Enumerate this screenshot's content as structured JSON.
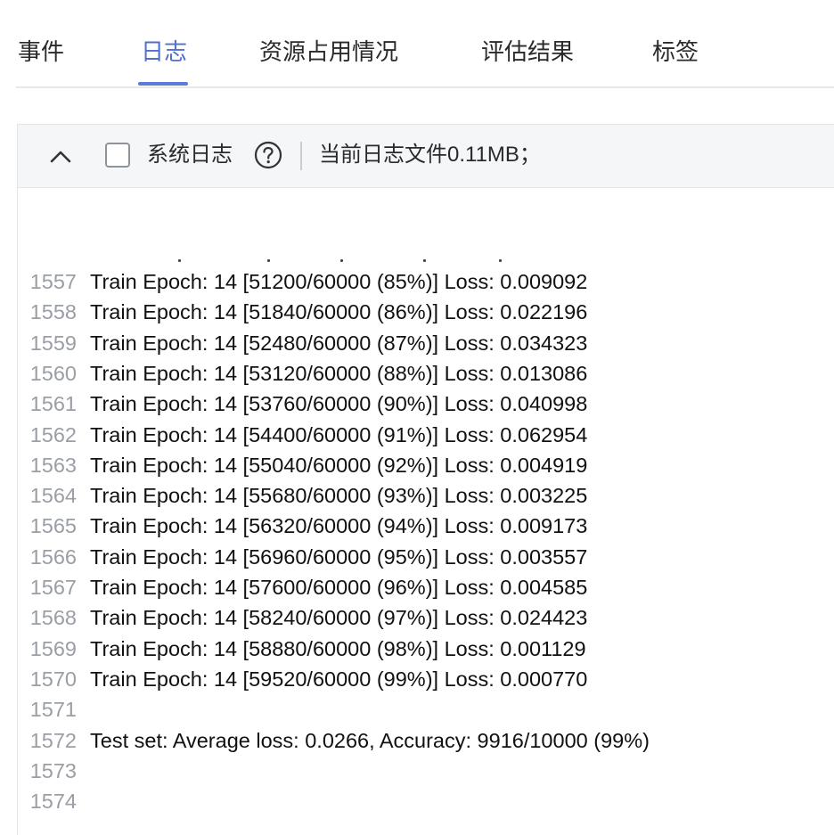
{
  "tabs": [
    {
      "label": "事件"
    },
    {
      "label": "日志"
    },
    {
      "label": "资源占用情况"
    },
    {
      "label": "评估结果"
    },
    {
      "label": "标签"
    }
  ],
  "active_tab": "日志",
  "toolbar": {
    "system_log_label": "系统日志",
    "system_log_checked": false,
    "file_size_text": "当前日志文件0.11MB；"
  },
  "icons": {
    "collapse": "chevron-up-icon",
    "help": "question-circle-icon"
  },
  "colors": {
    "accent": "#4f6fd1",
    "line_number": "#9a9ea5",
    "toolbar_bg": "#f5f6f8"
  },
  "log": {
    "lines": [
      {
        "no": "1557",
        "text": "Train Epoch: 14 [51200/60000 (85%)] Loss: 0.009092"
      },
      {
        "no": "1558",
        "text": "Train Epoch: 14 [51840/60000 (86%)] Loss: 0.022196"
      },
      {
        "no": "1559",
        "text": "Train Epoch: 14 [52480/60000 (87%)] Loss: 0.034323"
      },
      {
        "no": "1560",
        "text": "Train Epoch: 14 [53120/60000 (88%)] Loss: 0.013086"
      },
      {
        "no": "1561",
        "text": "Train Epoch: 14 [53760/60000 (90%)] Loss: 0.040998"
      },
      {
        "no": "1562",
        "text": "Train Epoch: 14 [54400/60000 (91%)] Loss: 0.062954"
      },
      {
        "no": "1563",
        "text": "Train Epoch: 14 [55040/60000 (92%)] Loss: 0.004919"
      },
      {
        "no": "1564",
        "text": "Train Epoch: 14 [55680/60000 (93%)] Loss: 0.003225"
      },
      {
        "no": "1565",
        "text": "Train Epoch: 14 [56320/60000 (94%)] Loss: 0.009173"
      },
      {
        "no": "1566",
        "text": "Train Epoch: 14 [56960/60000 (95%)] Loss: 0.003557"
      },
      {
        "no": "1567",
        "text": "Train Epoch: 14 [57600/60000 (96%)] Loss: 0.004585"
      },
      {
        "no": "1568",
        "text": "Train Epoch: 14 [58240/60000 (97%)] Loss: 0.024423"
      },
      {
        "no": "1569",
        "text": "Train Epoch: 14 [58880/60000 (98%)] Loss: 0.001129"
      },
      {
        "no": "1570",
        "text": "Train Epoch: 14 [59520/60000 (99%)] Loss: 0.000770"
      },
      {
        "no": "1571",
        "text": ""
      },
      {
        "no": "1572",
        "text": "Test set: Average loss: 0.0266, Accuracy: 9916/10000 (99%)"
      },
      {
        "no": "1573",
        "text": ""
      },
      {
        "no": "1574",
        "text": ""
      }
    ]
  }
}
